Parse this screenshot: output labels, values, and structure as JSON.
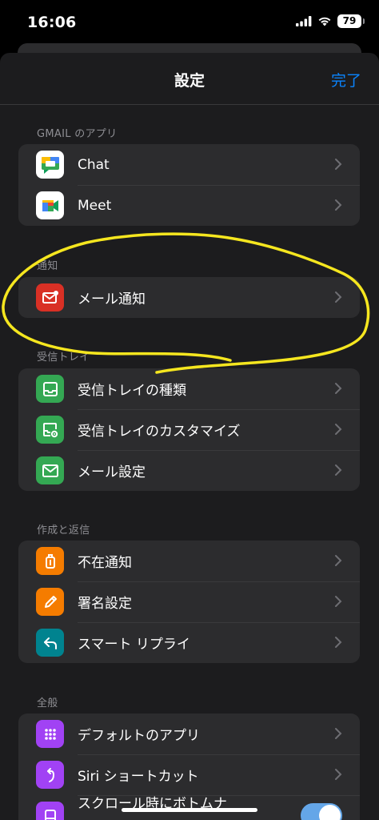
{
  "status_bar": {
    "time": "16:06",
    "battery": "79"
  },
  "nav": {
    "title": "設定",
    "done": "完了"
  },
  "sections": {
    "gmail_apps": {
      "header": "GMAIL のアプリ",
      "items": [
        {
          "label": "Chat",
          "icon": "google-chat-icon"
        },
        {
          "label": "Meet",
          "icon": "google-meet-icon"
        }
      ]
    },
    "notifications": {
      "header": "通知",
      "items": [
        {
          "label": "メール通知",
          "icon": "mail-notification-icon",
          "icon_color": "#d93025"
        }
      ]
    },
    "inbox": {
      "header": "受信トレイ",
      "items": [
        {
          "label": "受信トレイの種類",
          "icon": "inbox-icon",
          "icon_color": "#34a853"
        },
        {
          "label": "受信トレイのカスタマイズ",
          "icon": "inbox-settings-icon",
          "icon_color": "#34a853"
        },
        {
          "label": "メール設定",
          "icon": "mail-icon",
          "icon_color": "#34a853"
        }
      ]
    },
    "compose": {
      "header": "作成と返信",
      "items": [
        {
          "label": "不在通知",
          "icon": "luggage-icon",
          "icon_color": "#f57c00"
        },
        {
          "label": "署名設定",
          "icon": "pen-icon",
          "icon_color": "#f57c00"
        },
        {
          "label": "スマート リプライ",
          "icon": "reply-icon",
          "icon_color": "#00838f"
        }
      ]
    },
    "general": {
      "header": "全般",
      "items": [
        {
          "label": "デフォルトのアプリ",
          "icon": "apps-grid-icon",
          "icon_color": "#a142f4"
        },
        {
          "label": "Siri ショートカット",
          "icon": "siri-shortcut-icon",
          "icon_color": "#a142f4"
        },
        {
          "label": "スクロール時にボトムナ",
          "icon": "scroll-icon",
          "icon_color": "#a142f4",
          "toggle": true
        }
      ]
    }
  },
  "colors": {
    "accent": "#0a84ff",
    "annotation": "#f5e61f"
  }
}
